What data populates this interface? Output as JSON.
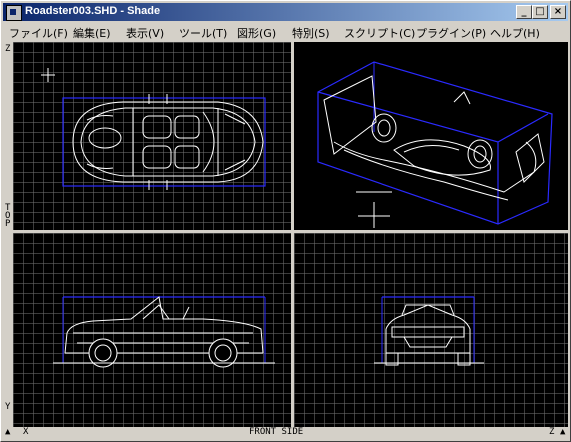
{
  "window": {
    "title": "Roadster003.SHD - Shade",
    "controls": {
      "minimize": "_",
      "maximize": "□",
      "close": "×"
    }
  },
  "menu": [
    "ファイル(F)",
    "編集(E)",
    "表示(V)",
    "ツール(T)",
    "図形(G)",
    "特別(S)",
    "スクリプト(C)",
    "プラグイン(P)",
    "ヘルプ(H)"
  ],
  "views": {
    "top": {
      "axis_top": "Z",
      "axis_bottom": "TOP"
    },
    "front": {
      "axis_top": "Y",
      "axis_bottom": "X",
      "name": "FRONT"
    },
    "side": {
      "name": "SIDE",
      "axis_right": "Z"
    }
  },
  "bottom_bar": {
    "label": "FRONT  SIDE"
  },
  "colors": {
    "wire": "#ffffff",
    "bbox": "#2a2aff",
    "grid": "#5a5a5a",
    "titlebar_start": "#0a246a",
    "titlebar_end": "#a6caf0"
  }
}
